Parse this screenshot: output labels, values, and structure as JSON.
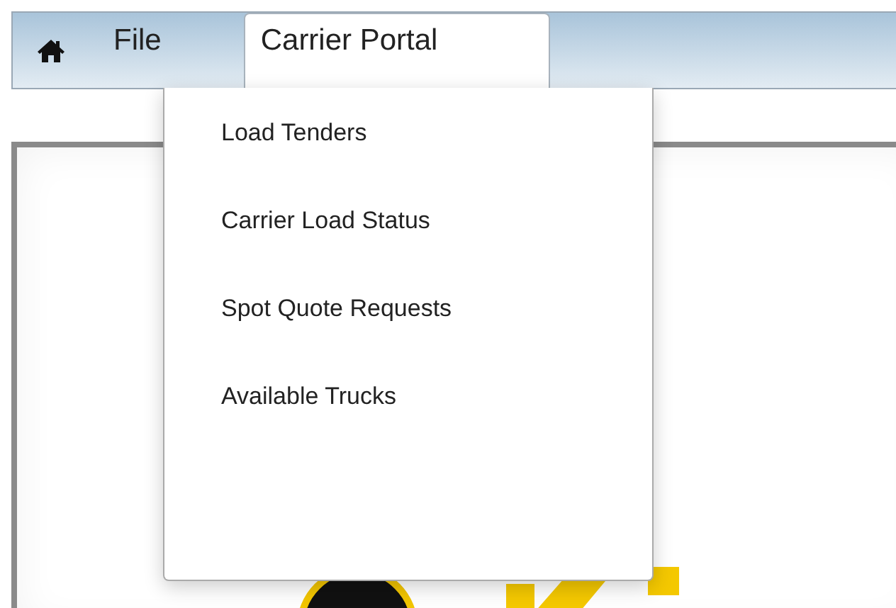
{
  "menu_bar": {
    "items": [
      {
        "label": "File",
        "selected": false
      },
      {
        "label": "Carrier Portal",
        "selected": true
      }
    ]
  },
  "dropdown": {
    "items": [
      {
        "label": "Load Tenders"
      },
      {
        "label": "Carrier Load Status"
      },
      {
        "label": "Spot Quote Requests"
      },
      {
        "label": "Available Trucks"
      }
    ]
  }
}
